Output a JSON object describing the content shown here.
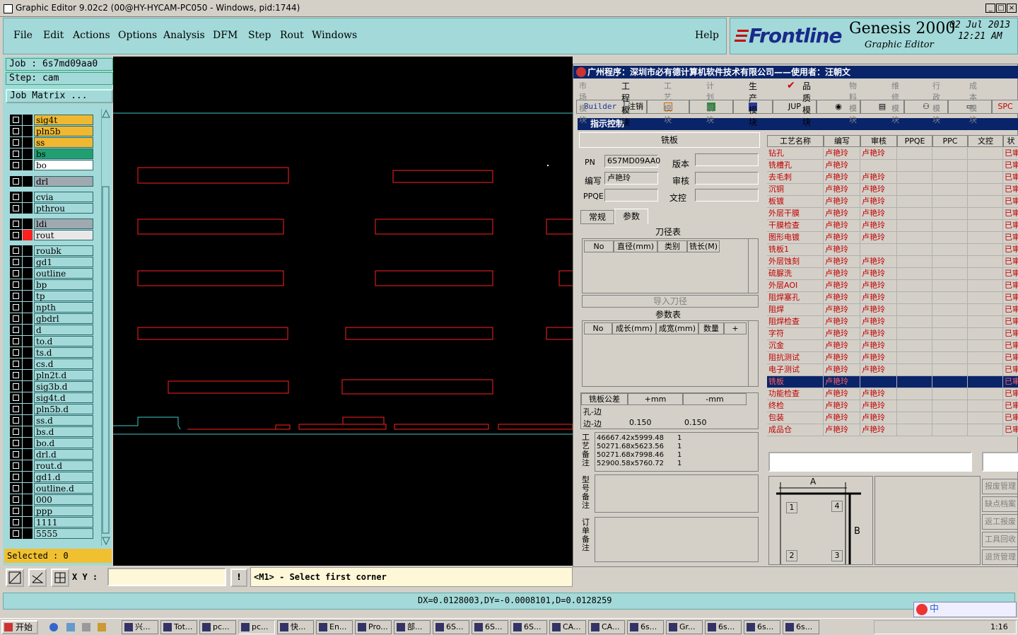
{
  "window": {
    "title": "Graphic Editor 9.02c2 (00@HY-HYCAM-PC050 - Windows, pid:1744)",
    "minimize": "_",
    "maximize": "□",
    "close": "×"
  },
  "menu": {
    "items": [
      "File",
      "Edit",
      "Actions",
      "Options",
      "Analysis",
      "DFM",
      "Step",
      "Rout",
      "Windows"
    ],
    "help": "Help"
  },
  "brand": {
    "logo": "Frontline",
    "product": "Genesis 2000",
    "subtitle": "Graphic Editor",
    "date": "02 Jul 2013",
    "time": "12:21 AM"
  },
  "job": {
    "job_line": "Job : 6s7md09aa0",
    "step_line": "Step: cam",
    "matrix_button": "Job Matrix ...",
    "selected": "Selected : 0"
  },
  "colors": {
    "layer_yellow": "#f0b830",
    "layer_green": "#20a070",
    "layer_white": "#ffffff",
    "layer_gray": "#a0a8b0",
    "layer_cyan": "#a3d9d9",
    "canvas_red": "#ff2020",
    "canvas_cyan": "#40c8c8",
    "selected_row": "#0a246a"
  },
  "layers": [
    {
      "name": "sig4t",
      "bg": "#f0b830"
    },
    {
      "name": "pln5b",
      "bg": "#f0b830"
    },
    {
      "name": "ss",
      "bg": "#f0b830"
    },
    {
      "name": "bs",
      "bg": "#20a070"
    },
    {
      "name": "bo",
      "bg": "#ffffff"
    },
    {
      "name": "drl",
      "bg": "#a0a8b0"
    },
    {
      "name": "cvia",
      "bg": "#a3d9d9"
    },
    {
      "name": "pthrou",
      "bg": "#a3d9d9"
    },
    {
      "name": "ldi",
      "bg": "#a0a8b0"
    },
    {
      "name": "rout",
      "bg": "#e8e8e8"
    },
    {
      "name": "roubk",
      "bg": "#a3d9d9"
    },
    {
      "name": "gd1",
      "bg": "#a3d9d9"
    },
    {
      "name": "outline",
      "bg": "#a3d9d9"
    },
    {
      "name": "bp",
      "bg": "#a3d9d9"
    },
    {
      "name": "tp",
      "bg": "#a3d9d9"
    },
    {
      "name": "npth",
      "bg": "#a3d9d9"
    },
    {
      "name": "gbdrl",
      "bg": "#a3d9d9"
    },
    {
      "name": "d",
      "bg": "#a3d9d9"
    },
    {
      "name": "to.d",
      "bg": "#a3d9d9"
    },
    {
      "name": "ts.d",
      "bg": "#a3d9d9"
    },
    {
      "name": "cs.d",
      "bg": "#a3d9d9"
    },
    {
      "name": "pln2t.d",
      "bg": "#a3d9d9"
    },
    {
      "name": "sig3b.d",
      "bg": "#a3d9d9"
    },
    {
      "name": "sig4t.d",
      "bg": "#a3d9d9"
    },
    {
      "name": "pln5b.d",
      "bg": "#a3d9d9"
    },
    {
      "name": "ss.d",
      "bg": "#a3d9d9"
    },
    {
      "name": "bs.d",
      "bg": "#a3d9d9"
    },
    {
      "name": "bo.d",
      "bg": "#a3d9d9"
    },
    {
      "name": "drl.d",
      "bg": "#a3d9d9"
    },
    {
      "name": "rout.d",
      "bg": "#a3d9d9"
    },
    {
      "name": "gd1.d",
      "bg": "#a3d9d9"
    },
    {
      "name": "outline.d",
      "bg": "#a3d9d9"
    },
    {
      "name": "000",
      "bg": "#a3d9d9"
    },
    {
      "name": "ppp",
      "bg": "#a3d9d9"
    },
    {
      "name": "1111",
      "bg": "#a3d9d9"
    },
    {
      "name": "5555",
      "bg": "#a3d9d9"
    }
  ],
  "coords": {
    "xy_label": "X Y :",
    "xy_value": "",
    "prompt": "<M1> - Select first corner",
    "status": "DX=0.0128003,DY=-0.0008101,D=0.0128259"
  },
  "erp": {
    "title": "广州程序：深圳市必有德计算机软件技术有限公司——使用者：汪朝文",
    "modules": [
      "市场模块",
      "工程模块",
      "工艺模块",
      "计划模块",
      "生产模块",
      "品质模块",
      "物料模块",
      "维修模块",
      "行政模块",
      "成本模块"
    ],
    "toolbar": [
      "Builder",
      "注销",
      "JUP",
      "SPC"
    ],
    "inner_title": "指示控制",
    "section": "铣板",
    "pn_label": "PN",
    "pn_value": "6S7MD09AA0",
    "version_label": "版本",
    "writer_label": "编写",
    "writer_value": "卢艳玲",
    "review_label": "审核",
    "ppqe_label": "PPQE",
    "doc_label": "文控",
    "tabs": [
      "常规",
      "参数"
    ],
    "tool_table": {
      "title": "刀径表",
      "headers": [
        "No",
        "直径(mm)",
        "类别",
        "铣长(M)"
      ],
      "button": "导入刀径"
    },
    "param_table": {
      "title": "参数表",
      "headers": [
        "No",
        "成长(mm)",
        "成宽(mm)",
        "数量",
        "+"
      ]
    },
    "tolerance": {
      "headers": [
        "铣板公差",
        "+mm",
        "-mm"
      ],
      "rows": [
        [
          "孔-边",
          "",
          ""
        ],
        [
          "边-边",
          "0.150",
          "0.150"
        ]
      ]
    },
    "process_notes_label": "工艺备注",
    "process_notes": [
      [
        "46667.42x5999.48",
        "1"
      ],
      [
        "50271.68x5623.56",
        "1"
      ],
      [
        "50271.68x7998.46",
        "1"
      ],
      [
        "52900.58x5760.72",
        "1"
      ]
    ],
    "model_notes_label": "型号备注",
    "order_notes_label": "订单备注",
    "grid_headers": [
      "工艺名称",
      "编写",
      "审核",
      "PPQE",
      "PPC",
      "文控",
      "状"
    ],
    "grid_rows": [
      [
        "钻孔",
        "卢艳玲",
        "卢艳玲",
        "已审"
      ],
      [
        "铣槽孔",
        "卢艳玲",
        "",
        "已审"
      ],
      [
        "去毛刺",
        "卢艳玲",
        "卢艳玲",
        "已审"
      ],
      [
        "沉铜",
        "卢艳玲",
        "卢艳玲",
        "已审"
      ],
      [
        "板镀",
        "卢艳玲",
        "卢艳玲",
        "已审"
      ],
      [
        "外层干膜",
        "卢艳玲",
        "卢艳玲",
        "已审"
      ],
      [
        "干膜检查",
        "卢艳玲",
        "卢艳玲",
        "已审"
      ],
      [
        "图形电镀",
        "卢艳玲",
        "卢艳玲",
        "已审"
      ],
      [
        "铣板1",
        "卢艳玲",
        "",
        "已审"
      ],
      [
        "外层蚀刻",
        "卢艳玲",
        "卢艳玲",
        "已审"
      ],
      [
        "硫脲洗",
        "卢艳玲",
        "卢艳玲",
        "已审"
      ],
      [
        "外层AOI",
        "卢艳玲",
        "卢艳玲",
        "已审"
      ],
      [
        "阻焊塞孔",
        "卢艳玲",
        "卢艳玲",
        "已审"
      ],
      [
        "阻焊",
        "卢艳玲",
        "卢艳玲",
        "已审"
      ],
      [
        "阻焊检查",
        "卢艳玲",
        "卢艳玲",
        "已审"
      ],
      [
        "字符",
        "卢艳玲",
        "卢艳玲",
        "已审"
      ],
      [
        "沉金",
        "卢艳玲",
        "卢艳玲",
        "已审"
      ],
      [
        "阻抗测试",
        "卢艳玲",
        "卢艳玲",
        "已审"
      ],
      [
        "电子测试",
        "卢艳玲",
        "卢艳玲",
        "已审"
      ],
      [
        "铣板",
        "卢艳玲",
        "",
        "已审"
      ],
      [
        "功能检查",
        "卢艳玲",
        "卢艳玲",
        "已审"
      ],
      [
        "终检",
        "卢艳玲",
        "卢艳玲",
        "已审"
      ],
      [
        "包装",
        "卢艳玲",
        "卢艳玲",
        "已审"
      ],
      [
        "成品仓",
        "卢艳玲",
        "卢艳玲",
        "已审"
      ]
    ],
    "selected_row": 19,
    "side_buttons": [
      "报废管理",
      "缺点档案",
      "返工报废",
      "工具回收",
      "退货管理"
    ],
    "diagram_labels": {
      "a": "A",
      "b": "B",
      "n1": "1",
      "n2": "2",
      "n3": "3",
      "n4": "4"
    }
  },
  "taskbar": {
    "start": "开始",
    "tasks": [
      "兴...",
      "Tot...",
      "pc...",
      "pc...",
      "快...",
      "En...",
      "Pro...",
      "部...",
      "6S...",
      "6S...",
      "6S...",
      "CA...",
      "CA...",
      "6s...",
      "Gr...",
      "6s...",
      "6s...",
      "6s..."
    ],
    "clock": "1:16",
    "ime": "中"
  }
}
